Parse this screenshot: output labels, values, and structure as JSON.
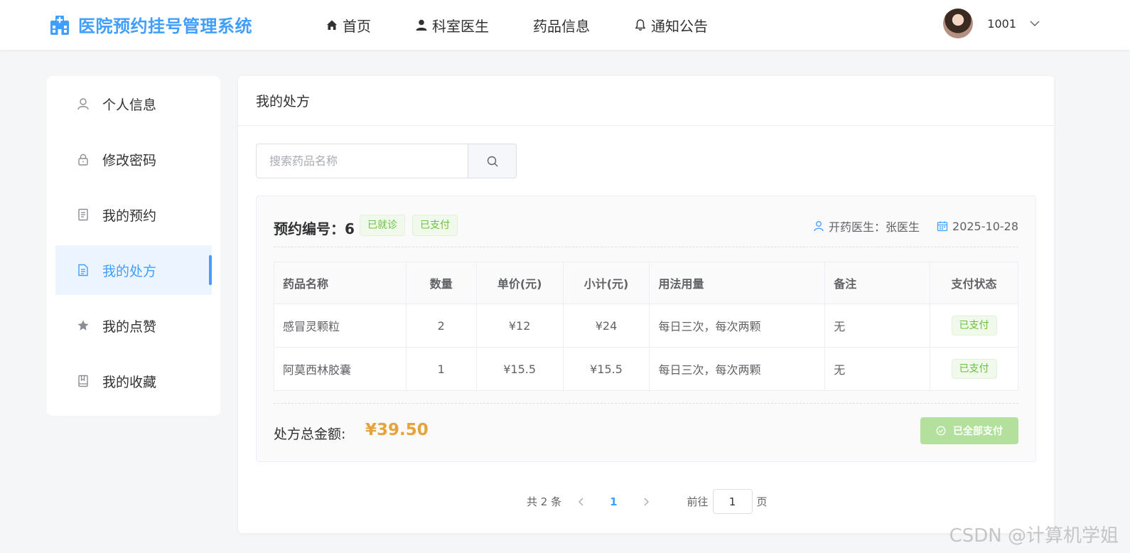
{
  "app": {
    "title": "医院预约挂号管理系统",
    "accent_color": "#409eff",
    "logo_icon": "hospital-icon"
  },
  "nav": [
    {
      "label": "首页",
      "icon": "home-icon"
    },
    {
      "label": "科室医生",
      "icon": "user-icon"
    },
    {
      "label": "药品信息",
      "icon": ""
    },
    {
      "label": "通知公告",
      "icon": "bell-icon"
    }
  ],
  "user": {
    "name": "1001"
  },
  "sidebar": {
    "items": [
      {
        "label": "个人信息",
        "icon": "user-icon",
        "active": false
      },
      {
        "label": "修改密码",
        "icon": "lock-icon",
        "active": false
      },
      {
        "label": "我的预约",
        "icon": "document-icon",
        "active": false
      },
      {
        "label": "我的处方",
        "icon": "prescription-icon",
        "active": true
      },
      {
        "label": "我的点赞",
        "icon": "star-icon",
        "active": false
      },
      {
        "label": "我的收藏",
        "icon": "bookmark-icon",
        "active": false
      }
    ]
  },
  "main": {
    "title": "我的处方",
    "search": {
      "placeholder": "搜索药品名称",
      "value": ""
    },
    "prescription": {
      "id_label": "预约编号：",
      "id": "6",
      "tags": [
        "已就诊",
        "已支付"
      ],
      "doctor_label": "开药医生：",
      "doctor": "张医生",
      "date": "2025-10-28",
      "columns": [
        "药品名称",
        "数量",
        "单价(元)",
        "小计(元)",
        "用法用量",
        "备注",
        "支付状态"
      ],
      "rows": [
        {
          "name": "感冒灵颗粒",
          "qty": "2",
          "price": "¥12",
          "subtotal": "¥24",
          "usage": "每日三次，每次两颗",
          "note": "无",
          "status": "已支付"
        },
        {
          "name": "阿莫西林胶囊",
          "qty": "1",
          "price": "¥15.5",
          "subtotal": "¥15.5",
          "usage": "每日三次，每次两颗",
          "note": "无",
          "status": "已支付"
        }
      ],
      "total_label": "处方总金额:",
      "total": "¥39.50",
      "paid_button": "已全部支付"
    },
    "pagination": {
      "total_text": "共 2 条",
      "current_page": "1",
      "goto_label": "前往",
      "goto_value": "1",
      "page_suffix": "页"
    }
  },
  "watermark": "CSDN @计算机学姐"
}
